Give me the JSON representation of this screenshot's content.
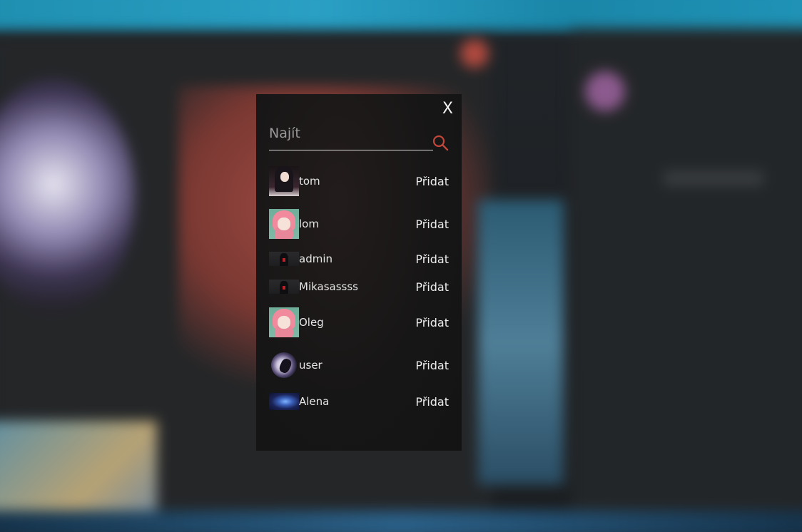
{
  "modal": {
    "close_label": "X",
    "search": {
      "placeholder": "Najít",
      "value": ""
    },
    "add_label": "Přidat",
    "users": [
      {
        "name": "tom"
      },
      {
        "name": "lom"
      },
      {
        "name": "admin"
      },
      {
        "name": "Mikasassss"
      },
      {
        "name": "Oleg"
      },
      {
        "name": "user"
      },
      {
        "name": "Alena"
      }
    ]
  },
  "colors": {
    "accent": "#c2473b",
    "modal_bg": "#161515",
    "text": "#e6e6e6"
  }
}
